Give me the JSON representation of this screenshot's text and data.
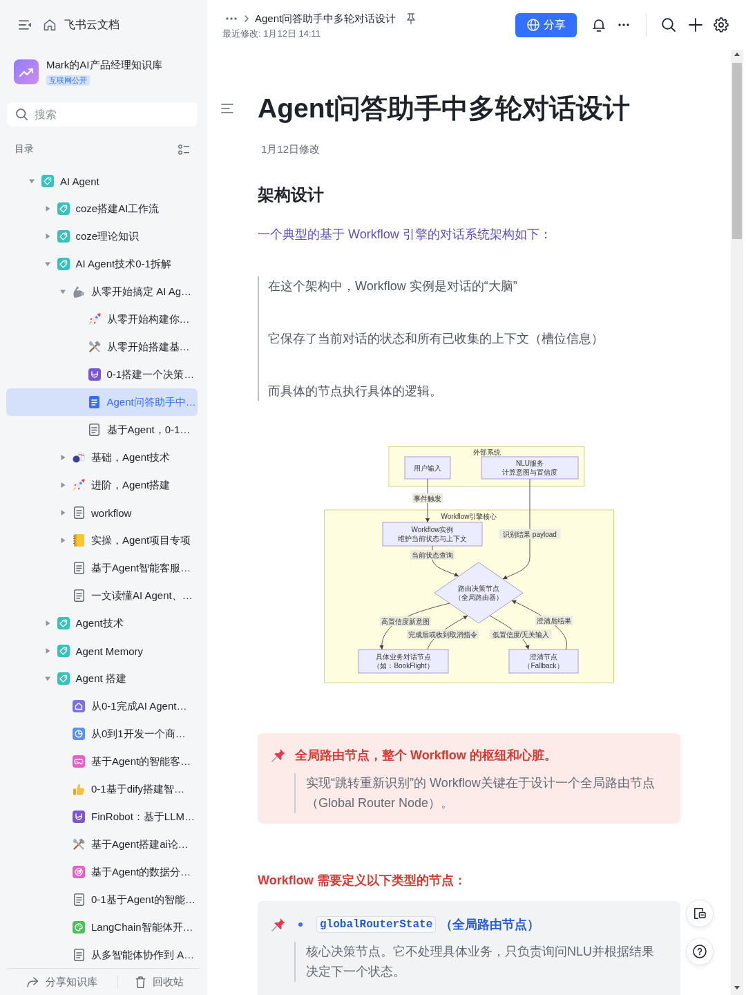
{
  "sidebar": {
    "app_name": "飞书云文档",
    "space": {
      "name": "Mark的AI产品经理知识库",
      "badge": "互联网公开"
    },
    "search": {
      "placeholder": "搜索"
    },
    "toc_label": "目录",
    "tree": [
      {
        "title": "AI Agent",
        "kind": "wiki",
        "expanded": true,
        "selected": false,
        "children": [
          {
            "title": "coze搭建AI工作流",
            "kind": "wiki",
            "expanded": false,
            "selected": false
          },
          {
            "title": "coze理论知识",
            "kind": "wiki",
            "expanded": false,
            "selected": false
          },
          {
            "title": "AI Agent技术0-1拆解",
            "kind": "wiki",
            "expanded": true,
            "selected": false,
            "children": [
              {
                "title": "从零开始搞定 AI Ag…",
                "kind": "arm",
                "expanded": true,
                "selected": false,
                "children": [
                  {
                    "title": "从零开始构建你…",
                    "kind": "rocket",
                    "selected": false
                  },
                  {
                    "title": "从零开始搭建基…",
                    "kind": "tools",
                    "selected": false
                  },
                  {
                    "title": "0-1搭建一个决策…",
                    "kind": "wave",
                    "selected": false
                  },
                  {
                    "title": "Agent问答助手中…",
                    "kind": "doc",
                    "selected": true
                  },
                  {
                    "title": "基于Agent，0-1…",
                    "kind": "doc",
                    "selected": false
                  }
                ]
              },
              {
                "title": "基础，Agent技术",
                "kind": "bowling",
                "expanded": false,
                "selected": false
              },
              {
                "title": "进阶，Agent搭建",
                "kind": "rocket",
                "expanded": false,
                "selected": false
              },
              {
                "title": "workflow",
                "kind": "doc",
                "expanded": false,
                "selected": false
              },
              {
                "title": "实操，Agent项目专项",
                "kind": "notebook",
                "expanded": false,
                "selected": false
              },
              {
                "title": "基于Agent智能客服…",
                "kind": "doc",
                "selected": false
              },
              {
                "title": "一文读懂AI Agent、…",
                "kind": "doc",
                "selected": false
              }
            ]
          },
          {
            "title": "Agent技术",
            "kind": "wiki",
            "expanded": false,
            "selected": false
          },
          {
            "title": "Agent Memory",
            "kind": "wiki",
            "expanded": false,
            "selected": false
          },
          {
            "title": "Agent 搭建",
            "kind": "wiki",
            "expanded": true,
            "selected": false,
            "children": [
              {
                "title": "从0-1完成AI Agent…",
                "kind": "house",
                "selected": false
              },
              {
                "title": "从0到1开发一个商…",
                "kind": "pie",
                "selected": false
              },
              {
                "title": "基于Agent的智能客…",
                "kind": "gamepad",
                "selected": false
              },
              {
                "title": "0-1基于dify搭建智…",
                "kind": "thumbsup",
                "selected": false
              },
              {
                "title": "FinRobot：基于LLM…",
                "kind": "wave",
                "selected": false
              },
              {
                "title": "基于Agent搭建ai论…",
                "kind": "tools",
                "selected": false
              },
              {
                "title": "基于Agent的数据分…",
                "kind": "target",
                "selected": false
              },
              {
                "title": "0-1基于Agent的智能…",
                "kind": "doc",
                "selected": false
              },
              {
                "title": "LangChain智能体开…",
                "kind": "palette",
                "selected": false
              },
              {
                "title": "从多智能体协作到 A…",
                "kind": "doc",
                "selected": false
              }
            ]
          }
        ]
      }
    ],
    "footer": [
      {
        "kind": "share",
        "label": "分享知识库"
      },
      {
        "kind": "trash",
        "label": "回收站"
      }
    ]
  },
  "topbar": {
    "title": "Agent问答助手中多轮对话设计",
    "last_modified": "最近修改: 1月12日 14:11",
    "share_button": "分享"
  },
  "document": {
    "title": "Agent问答助手中多轮对话设计",
    "edited": "1月12日修改",
    "heading": "架构设计",
    "intro": "一个典型的基于 Workflow 引擎的对话系统架构如下：",
    "quote": [
      "在这个架构中，Workflow 实例是对话的“大脑”",
      "它保存了当前对话的状态和所有已收集的上下文（槽位信息）",
      "而具体的节点执行具体的逻辑。"
    ],
    "diagram": {
      "clusters": [
        {
          "label": "外部系统"
        },
        {
          "label": "Workflow引擎核心"
        }
      ],
      "nodes": [
        {
          "kind": "process",
          "lines": [
            "用户输入"
          ]
        },
        {
          "kind": "process",
          "lines": [
            "NLU服务",
            "计算意图与置信度"
          ]
        },
        {
          "kind": "process",
          "lines": [
            "Workflow实例",
            "维护当前状态与上下文"
          ]
        },
        {
          "kind": "decision",
          "lines": [
            "路由决策节点",
            "（全局路由器）"
          ]
        },
        {
          "kind": "process",
          "lines": [
            "具体业务对话节点",
            "（如：BookFlight）"
          ]
        },
        {
          "kind": "process",
          "lines": [
            "澄清节点",
            "（Fallback）"
          ]
        }
      ],
      "edges": [
        {
          "label": "事件触发"
        },
        {
          "label": "识别结果 payload"
        },
        {
          "label": "当前状态查询"
        },
        {
          "label": "高置信度新意图"
        },
        {
          "label": "完成后或收到取消指令"
        },
        {
          "label": "低置信度/无关输入"
        },
        {
          "label": "澄清后结果"
        }
      ]
    },
    "callout": {
      "title": "全局路由节点，整个 Workflow 的枢纽和心脏。",
      "body": "实现“跳转重新识别”的 Workflow关键在于设计一个全局路由节点（Global Router Node）。"
    },
    "section": "Workflow 需要定义以下类型的节点：",
    "node_card": {
      "code": "globalRouterState",
      "label": "（全局路由节点）",
      "body": "核心决策节点。它不处理具体业务，只负责询问NLU并根据结果决定下一个状态。"
    }
  }
}
